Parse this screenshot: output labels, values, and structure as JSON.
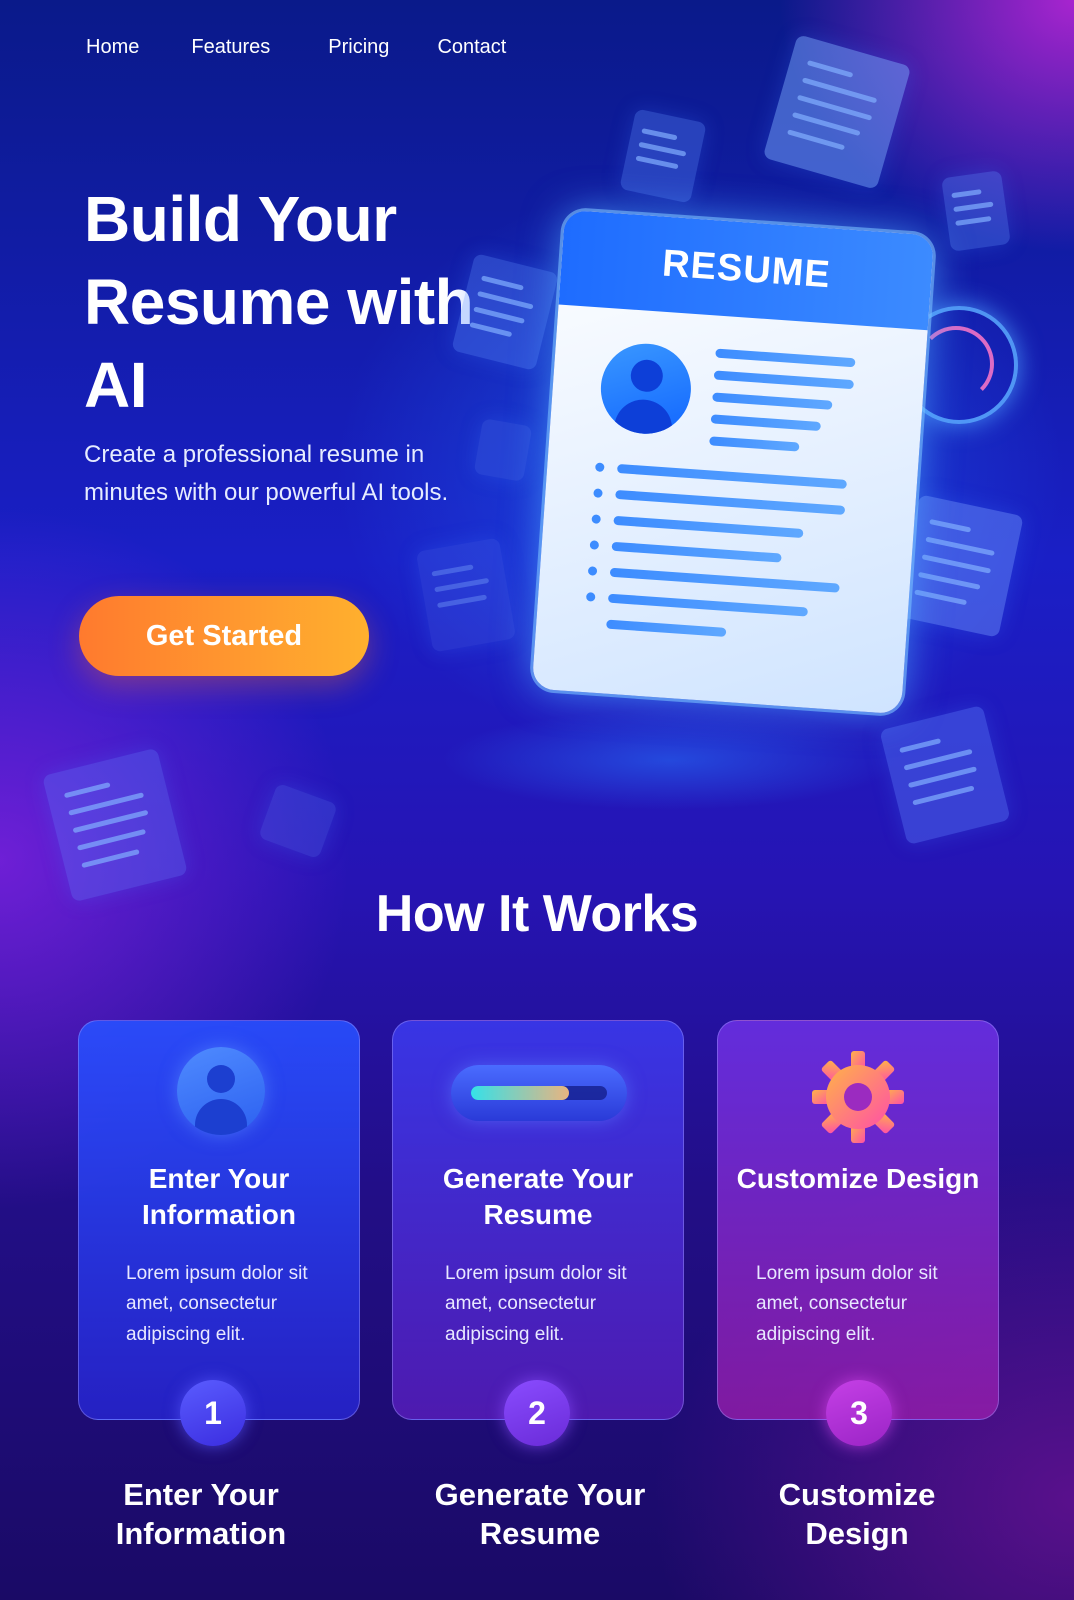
{
  "nav": {
    "items": [
      "Home",
      "Features",
      "Pricing",
      "Contact"
    ]
  },
  "hero": {
    "title": "Build Your Resume with AI",
    "subtitle": "Create a professional resume in minutes with our powerful AI tools.",
    "cta_label": "Get Started",
    "illustration_heading": "RESUME"
  },
  "how_it_works": {
    "title": "How It Works",
    "steps": [
      {
        "number": "1",
        "title": "Enter Your Information",
        "text": "Lorem ipsum dolor sit amet, consectetur adipiscing elit.",
        "icon": "user-icon",
        "label": "Enter Your Information"
      },
      {
        "number": "2",
        "title": "Generate Your Resume",
        "text": "Lorem ipsum dolor sit amet, consectetur adipiscing elit.",
        "icon": "progress-bar-icon",
        "label": "Generate Your Resume",
        "progress": 0.72
      },
      {
        "number": "3",
        "title": "Customize Design",
        "text": "Lorem ipsum dolor sit amet, consectetur adipiscing elit.",
        "icon": "gear-icon",
        "label": "Customize Design"
      }
    ]
  },
  "colors": {
    "cta_gradient_start": "#ff7a2e",
    "cta_gradient_end": "#ffb02e",
    "accent_blue": "#1e6cff",
    "accent_magenta": "#c540e6"
  }
}
